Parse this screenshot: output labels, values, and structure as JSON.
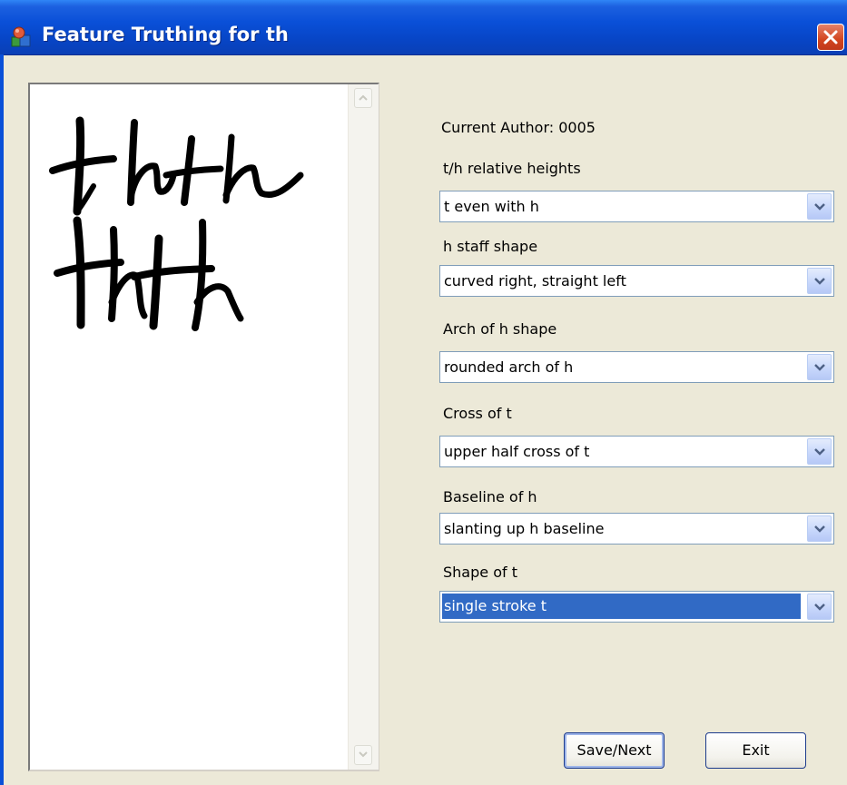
{
  "window": {
    "title": "Feature Truthing for th"
  },
  "author": {
    "text": "Current Author: 0005"
  },
  "fields": [
    {
      "label": "t/h relative heights",
      "value": "t even with h"
    },
    {
      "label": "h staff shape",
      "value": "curved right, straight left"
    },
    {
      "label": "Arch of h shape",
      "value": "rounded arch of h"
    },
    {
      "label": "Cross of t",
      "value": "upper half cross of t"
    },
    {
      "label": "Baseline of h",
      "value": "slanting up h baseline"
    },
    {
      "label": "Shape of t",
      "value": "single stroke t"
    }
  ],
  "buttons": {
    "save_label": "Save/Next",
    "exit_label": "Exit"
  },
  "icons": {
    "app": "app-icon",
    "close": "close-icon",
    "dropdown": "chevron-down-icon",
    "scroll_up": "arrow-up-icon",
    "scroll_down": "arrow-down-icon"
  },
  "colors": {
    "titlebar": "#0a50d8",
    "selection": "#316ac5",
    "close": "#d2451f",
    "dialog_bg": "#ece9d8"
  }
}
